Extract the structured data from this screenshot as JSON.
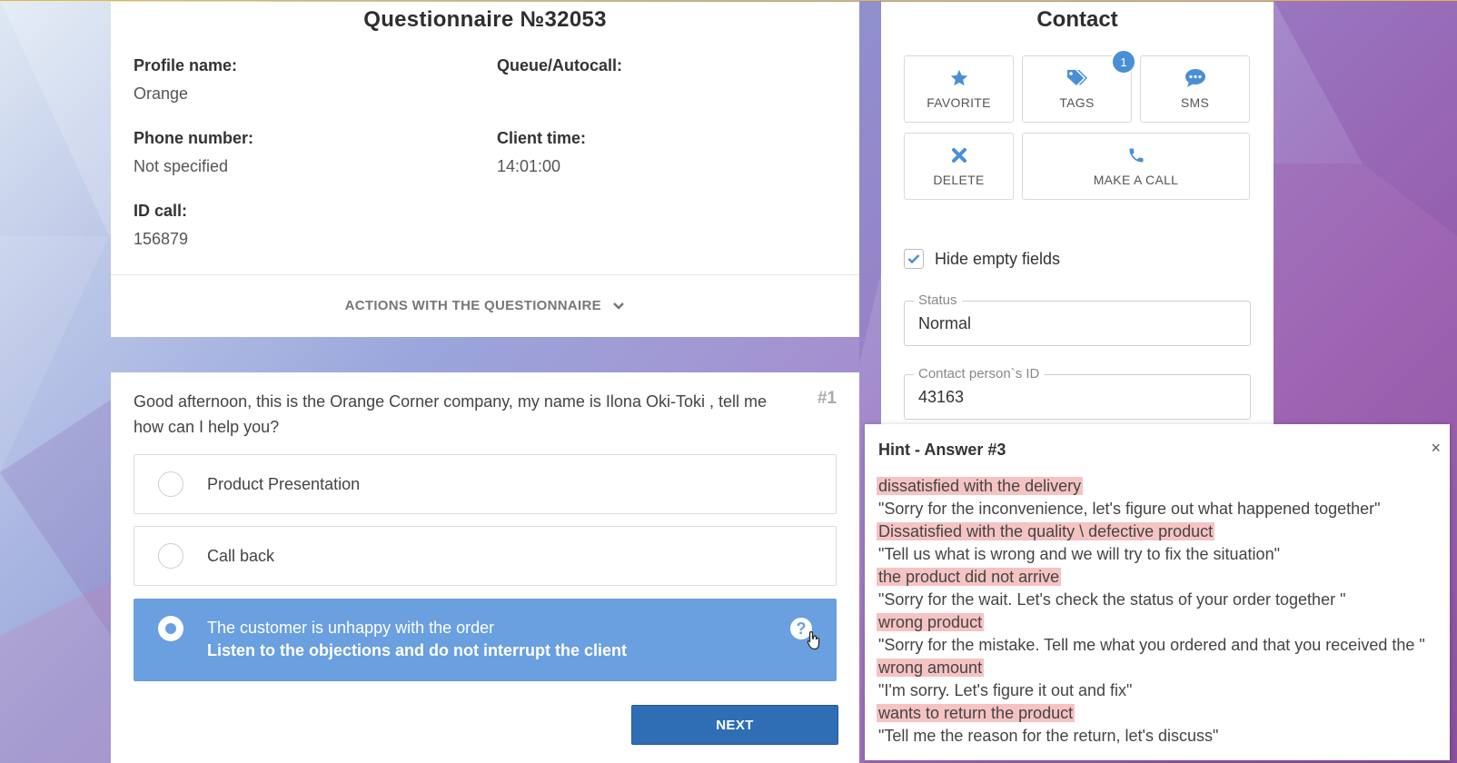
{
  "questionnaire": {
    "title": "Questionnaire №32053",
    "profile_label": "Profile name:",
    "profile_value": "Orange",
    "queue_label": "Queue/Autocall:",
    "queue_value": "",
    "phone_label": "Phone number:",
    "phone_value": "Not specified",
    "client_time_label": "Client time:",
    "client_time_value": "14:01:00",
    "id_call_label": "ID call:",
    "id_call_value": "156879",
    "actions_label": "ACTIONS WITH THE QUESTIONNAIRE"
  },
  "contact": {
    "title": "Contact",
    "buttons": {
      "favorite": "FAVORITE",
      "tags": "TAGS",
      "tags_badge": "1",
      "sms": "SMS",
      "delete": "DELETE",
      "call": "MAKE A CALL"
    },
    "hide_empty_label": "Hide empty fields",
    "hide_empty_checked": true,
    "status_label": "Status",
    "status_value": "Normal",
    "person_id_label": "Contact person`s ID",
    "person_id_value": "43163"
  },
  "script": {
    "question": "Good afternoon, this is the Orange Corner company, my name is Ilona Oki-Toki , tell me how can I help you?",
    "number": "#1",
    "options": [
      {
        "label": "Product Presentation",
        "selected": false
      },
      {
        "label": "Call back",
        "selected": false
      },
      {
        "label": "The customer is unhappy with the order",
        "sub": "Listen to the objections and do not interrupt the client",
        "selected": true
      }
    ],
    "help_icon": "?",
    "next_label": "NEXT"
  },
  "hint": {
    "title": "Hint - Answer #3",
    "close": "×",
    "lines": [
      {
        "text": "dissatisfied with the delivery",
        "highlight": true
      },
      {
        "text": "\"Sorry for the inconvenience, let's figure out what happened together\"",
        "highlight": false
      },
      {
        "text": "Dissatisfied with the quality \\ defective product",
        "highlight": true
      },
      {
        "text": "\"Tell us what is wrong and we will try to fix the situation\"",
        "highlight": false
      },
      {
        "text": "the product did not arrive",
        "highlight": true
      },
      {
        "text": "\"Sorry for the wait. Let's check the status of your order together \"",
        "highlight": false
      },
      {
        "text": "wrong product",
        "highlight": true
      },
      {
        "text": "\"Sorry for the mistake. Tell me what you ordered and that you received the \"",
        "highlight": false
      },
      {
        "text": "wrong amount",
        "highlight": true
      },
      {
        "text": "\"I'm sorry. Let's figure it out and fix\"",
        "highlight": false
      },
      {
        "text": "wants to return the product",
        "highlight": true
      },
      {
        "text": "\"Tell me the reason for the return, let's discuss\"",
        "highlight": false
      }
    ]
  },
  "colors": {
    "accent": "#4a8fd6",
    "selected_option": "#6a9fe0",
    "next_button": "#2f6db5",
    "highlight": "#f6c3c3"
  }
}
